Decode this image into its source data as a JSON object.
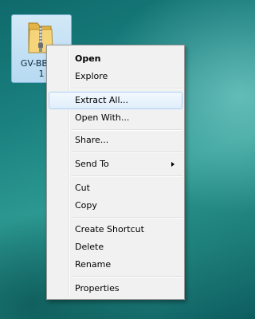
{
  "desktop": {
    "icon_label": "GV-BBV…\n1",
    "icon_type": "zip-folder-icon"
  },
  "context_menu": {
    "highlighted_item": "Extract All...",
    "items": [
      {
        "label": "Open",
        "bold": true
      },
      {
        "label": "Explore"
      },
      {
        "label": "Extract All..."
      },
      {
        "label": "Open With..."
      },
      {
        "label": "Share..."
      },
      {
        "label": "Send To",
        "submenu": true
      },
      {
        "label": "Cut"
      },
      {
        "label": "Copy"
      },
      {
        "label": "Create Shortcut"
      },
      {
        "label": "Delete"
      },
      {
        "label": "Rename"
      },
      {
        "label": "Properties"
      }
    ]
  },
  "colors": {
    "menu_background": "#f1f1f1",
    "menu_hover": "#e0eefb",
    "desktop": "#1a807f"
  }
}
